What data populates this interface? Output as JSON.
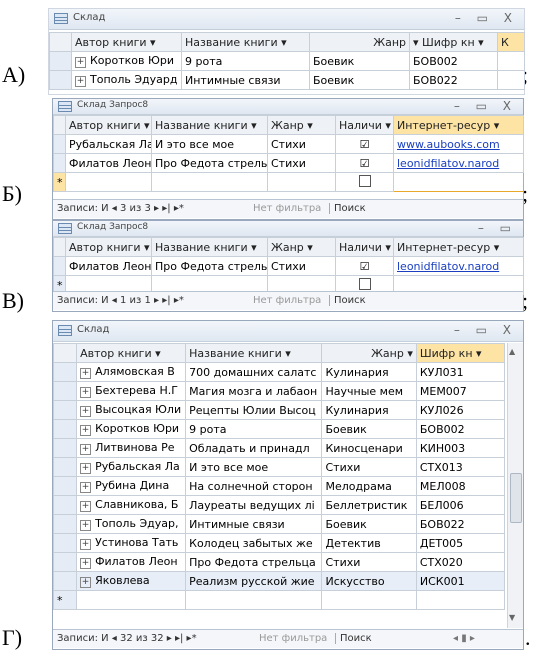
{
  "labels": {
    "a": "А)",
    "b": "Б)",
    "c": "В)",
    "d": "Г)",
    "sep": ";",
    "end": "."
  },
  "winA": {
    "title": "Склад",
    "controls": "– ▭ X",
    "headers": [
      "Автор книги ▾",
      "Название книги ▾",
      "Жанр",
      "▾ Шифр кн ▾",
      "К"
    ],
    "rows": [
      [
        "Коротков Юри",
        "9 рота",
        "Боевик",
        "БОВ002"
      ],
      [
        "Тополь Эдуард",
        "Интимные связи",
        "Боевик",
        "БОВ022"
      ]
    ]
  },
  "winB": {
    "title": "Склад Запрос8",
    "controls": "– ▭ X",
    "headers": [
      "Автор книги ▾",
      "Название книги ▾",
      "Жанр ▾",
      "Наличи ▾",
      "Интернет-ресур ▾"
    ],
    "rows": [
      [
        "Рубальская Ла",
        "И это все мое",
        "Стихи",
        "☑",
        "www.aubooks.com"
      ],
      [
        "Филатов Леони",
        "Про Федота стрельца",
        "Стихи",
        "☑",
        "leonidfilatov.narod"
      ]
    ],
    "new_row": "*",
    "status": {
      "records": "Записи: И ◂ 3 из 3 ▸ ▸| ▸*",
      "filter": "Нет фильтра",
      "search": "Поиск"
    }
  },
  "winC": {
    "title": "Склад Запрос8",
    "controls": "– ▭",
    "headers": [
      "Автор книги ▾",
      "Название книги ▾",
      "Жанр ▾",
      "Наличи ▾",
      "Интернет-ресур ▾"
    ],
    "rows": [
      [
        "Филатов Леони",
        "Про Федота стрельца",
        "Стихи",
        "☑",
        "leonidfilatov.narod"
      ]
    ],
    "new_row": "*",
    "status": {
      "records": "Записи: И ◂ 1 из 1 ▸ ▸| ▸*",
      "filter": "Нет фильтра",
      "search": "Поиск"
    }
  },
  "winD": {
    "title": "Склад",
    "controls": "– ▭ X",
    "headers": [
      "Автор книги ▾",
      "Название книги ▾",
      "Жанр ▾",
      "Шифр кн ▾"
    ],
    "rows": [
      [
        "Алямовская В",
        "700 домашних салатс",
        "Кулинария",
        "КУЛ031"
      ],
      [
        "Бехтерева Н.Г",
        "Магия мозга и лабаон",
        "Научные мем",
        "МЕМ007"
      ],
      [
        "Высоцкая Юли",
        "Рецепты Юлии Высоц",
        "Кулинария",
        "КУЛ026"
      ],
      [
        "Коротков Юри",
        "9 рота",
        "Боевик",
        "БОВ002"
      ],
      [
        "Литвинова Ре",
        "Обладать и принадл",
        "Киносценари",
        "КИН003"
      ],
      [
        "Рубальская Ла",
        "И это все мое",
        "Стихи",
        "СТХ013"
      ],
      [
        "Рубина Дина",
        "На солнечной сторон",
        "Мелодрама",
        "МЕЛ008"
      ],
      [
        "Славникова, Б",
        "Лауреаты ведущих лі",
        "Беллетристик",
        "БЕЛ006"
      ],
      [
        "Тополь Эдуар,",
        "Интимные связи",
        "Боевик",
        "БОВ022"
      ],
      [
        "Устинова Тать",
        "Колодец забытых же",
        "Детектив",
        "ДЕТ005"
      ],
      [
        "Филатов Леон",
        "Про Федота стрельца",
        "Стихи",
        "СТХ020"
      ],
      [
        "Яковлева",
        "Реализм русской жие",
        "Искусство",
        "ИСК001"
      ]
    ],
    "new_row": "*",
    "status": {
      "records": "Записи: И ◂ 32 из 32 ▸ ▸| ▸*",
      "filter": "Нет фильтра",
      "search": "Поиск"
    }
  }
}
